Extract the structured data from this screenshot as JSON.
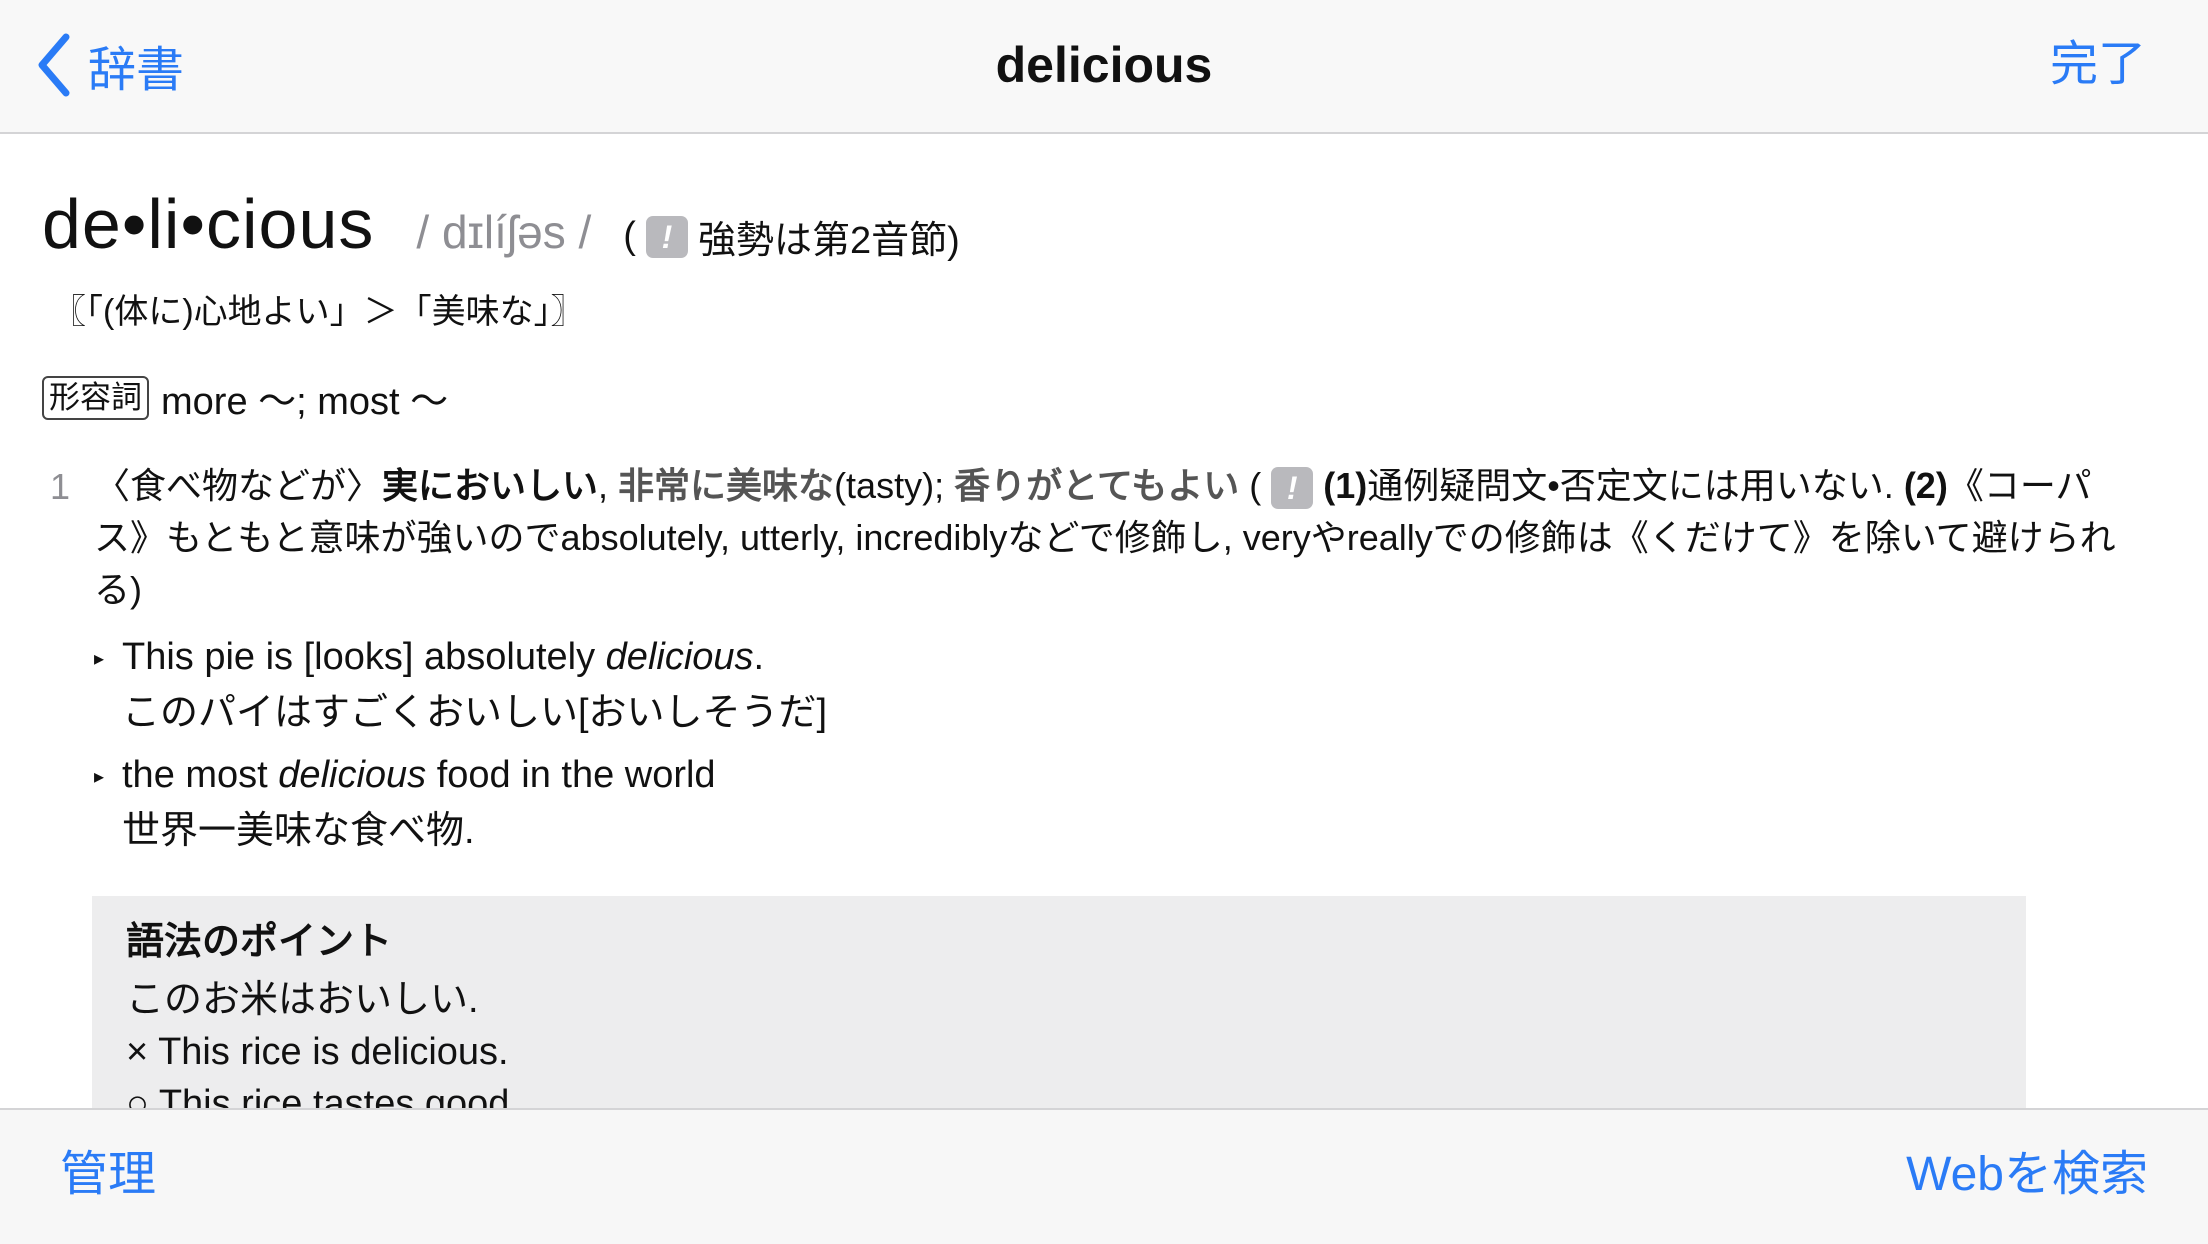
{
  "nav": {
    "back_label": "辞書",
    "title": "delicious",
    "done_label": "完了"
  },
  "entry": {
    "headword": "de•li•cious",
    "pronunciation": "/ dɪlíʃəs /",
    "stress_open": "(",
    "stress_note": "強勢は第2音節)",
    "note_icon": "!",
    "etymology": "〖「(体に)心地よい」＞「美味な」〗",
    "pos": "形容詞",
    "inflection": "more 〜; most 〜",
    "sense_number": "1",
    "sense": {
      "prefix": "〈食べ物などが〉",
      "bold1": "実においしい",
      "sep1": ", ",
      "bold2": "非常に美味な",
      "paren1": "(tasty); ",
      "bold3": "香りがとてもよい",
      "open": " (",
      "n1": "(1)",
      "text1": "通例疑問文•否定文には用いない. ",
      "n2": "(2)",
      "text2": "《コーパス》もともと意味が強いのでabsolutely, utterly, incrediblyなどで修飾し, veryやreallyでの修飾は《くだけて》を除いて避けられる)"
    },
    "examples": [
      {
        "en_before": "This pie is [looks] absolutely ",
        "en_italic": "delicious",
        "en_after": ".",
        "ja": "このパイはすごくおいしい[おいしそうだ]"
      },
      {
        "en_before": "the most ",
        "en_italic": "delicious",
        "en_after": " food in the world",
        "ja": "世界一美味な食べ物."
      }
    ],
    "usage": {
      "title": "語法のポイント",
      "lines": [
        "このお米はおいしい.",
        "× This rice is delicious.",
        "○ This rice tastes good."
      ]
    }
  },
  "toolbar": {
    "manage_label": "管理",
    "web_search_label": "Webを検索"
  },
  "colors": {
    "accent": "#2a7bf6",
    "secondary_text": "#8e8e93",
    "usage_box_bg": "#ededee"
  }
}
